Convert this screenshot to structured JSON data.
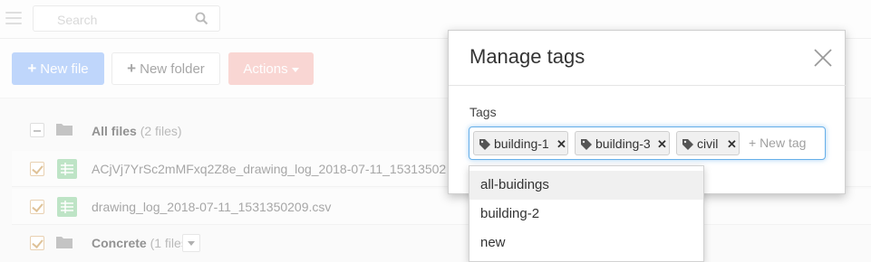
{
  "search": {
    "placeholder": "Search"
  },
  "toolbar": {
    "new_file_label": "New file",
    "new_folder_label": "New folder",
    "actions_label": "Actions"
  },
  "files": {
    "all_files_label": "All files",
    "all_files_count": "(2 files)",
    "rows": [
      {
        "name": "ACjVj7YrSc2mMFxq2Z8e_drawing_log_2018-07-11_15313502",
        "checked": true
      },
      {
        "name": "drawing_log_2018-07-11_1531350209.csv",
        "checked": true
      }
    ],
    "folder_label": "Concrete",
    "folder_count": "(1 files)"
  },
  "modal": {
    "title": "Manage tags",
    "tags_label": "Tags",
    "tags": [
      "building-1",
      "building-3",
      "civil"
    ],
    "new_tag_placeholder": "+ New tag",
    "suggestions": [
      "all-buidings",
      "building-2",
      "new"
    ]
  },
  "colors": {
    "primary": "#3b82f6",
    "danger": "#f07a70",
    "checkbox": "#c8964f",
    "file_icon": "#5cb85c",
    "focus": "#66afe9"
  }
}
